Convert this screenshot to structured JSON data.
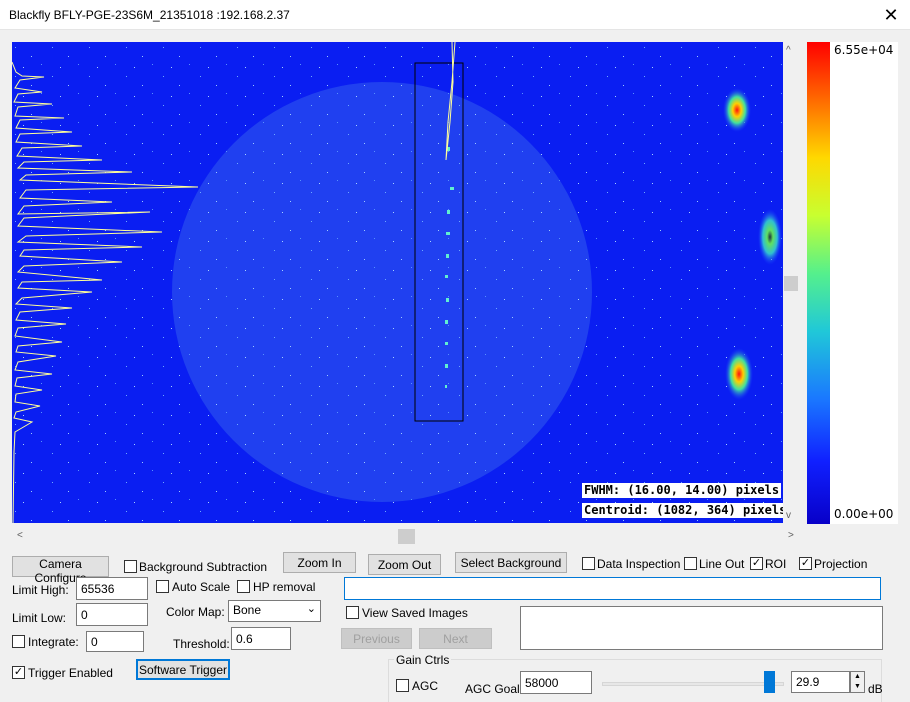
{
  "window": {
    "title": "Blackfly BFLY-PGE-23S6M_21351018 :192.168.2.37",
    "close_glyph": "✕"
  },
  "image_view": {
    "fwhm_label": "FWHM: (16.00, 14.00) pixels",
    "centroid_label": "Centroid: (1082, 364) pixels",
    "background_color": "#0a1ef2",
    "projection_color": "#ffff99"
  },
  "colorbar": {
    "max_label": "6.55e+04",
    "min_label": "0.00e+00"
  },
  "toolbar": {
    "camera_configure": "Camera Configure",
    "background_subtraction": "Background Subtraction",
    "zoom_in": "Zoom In",
    "zoom_out": "Zoom Out",
    "select_background": "Select Background",
    "data_inspection": "Data Inspection",
    "line_out": "Line Out",
    "roi": "ROI",
    "projection": "Projection"
  },
  "checks": {
    "background_subtraction": false,
    "data_inspection": false,
    "line_out": false,
    "roi": true,
    "projection": true,
    "auto_scale": false,
    "hp_removal": false,
    "integrate": false,
    "trigger_enabled": true,
    "view_saved_images": false,
    "agc": false
  },
  "limits": {
    "high_label": "Limit High:",
    "high_value": "65536",
    "low_label": "Limit Low:",
    "low_value": "0",
    "integrate_label": "Integrate:",
    "integrate_value": "0"
  },
  "options": {
    "auto_scale": "Auto Scale",
    "hp_removal": "HP removal",
    "color_map_label": "Color Map:",
    "color_map_value": "Bone",
    "threshold_label": "Threshold:",
    "threshold_value": "0.6",
    "trigger_enabled": "Trigger Enabled",
    "software_trigger": "Software Trigger"
  },
  "saved_images": {
    "path_value": "",
    "view_saved_images": "View Saved Images",
    "previous": "Previous",
    "next": "Next",
    "notes_value": ""
  },
  "gain": {
    "group_title": "Gain Ctrls",
    "agc": "AGC",
    "agc_goal_label": "AGC Goal:",
    "agc_goal_value": "58000",
    "gain_value": "29.9",
    "gain_unit": "dB",
    "slider_fraction": 0.95
  },
  "scroll": {
    "left_arrow": "<",
    "right_arrow": ">",
    "up_arrow": "^",
    "down_arrow": "v"
  }
}
